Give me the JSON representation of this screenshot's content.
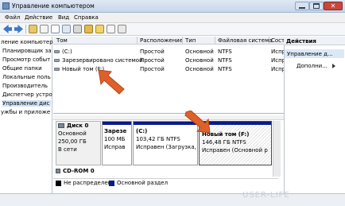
{
  "window": {
    "title": "Управление компьютером",
    "controls": [
      "minimize",
      "maximize",
      "close"
    ]
  },
  "menu": [
    "Файл",
    "Действие",
    "Вид",
    "Справка"
  ],
  "tree": {
    "items": [
      "ление компьютер",
      "Планировщик за",
      "Просмотр событ",
      "Общие папки",
      "Локальные поль",
      "Производитель",
      "Диспетчер устро",
      "Управление дис",
      "ужбы и приложе"
    ]
  },
  "volumes": {
    "columns": [
      "Том",
      "Расположение",
      "Тип",
      "Файловая система",
      "Сост"
    ],
    "rows": [
      {
        "name": "(C:)",
        "layout": "Простой",
        "type": "Основной",
        "fs": "NTFS",
        "status": "Испр"
      },
      {
        "name": "Зарезервировано системой",
        "layout": "Простой",
        "type": "Основной",
        "fs": "NTFS",
        "status": "Испр"
      },
      {
        "name": "Новый том (F:)",
        "layout": "Простой",
        "type": "Основной",
        "fs": "NTFS",
        "status": "Испр"
      }
    ]
  },
  "disks": [
    {
      "label": "Диск 0",
      "kind": "Основной",
      "size": "250,00 ГБ",
      "state": "В сети",
      "partitions": [
        {
          "name": "Зарезе",
          "size": "100 МБ",
          "status": "Исправ"
        },
        {
          "name": "(C:)",
          "size": "103,42 ГБ NTFS",
          "status": "Исправен (Загрузка, Фа"
        },
        {
          "name": "Новый том (F:)",
          "size": "146,48 ГБ NTFS",
          "status": "Исправен (Основной р"
        }
      ]
    },
    {
      "label": "CD-ROM 0"
    }
  ],
  "legend": [
    {
      "label": "Не распределен",
      "color": "#000000"
    },
    {
      "label": "Основной раздел",
      "color": "#0b1a8a"
    }
  ],
  "actions": {
    "header": "Действия",
    "section": "Управление д...",
    "item": "Дополни..."
  },
  "watermark": "USER-LIFE",
  "colors": {
    "accent": "#0b1a8a",
    "arrow": "#e0602a"
  }
}
